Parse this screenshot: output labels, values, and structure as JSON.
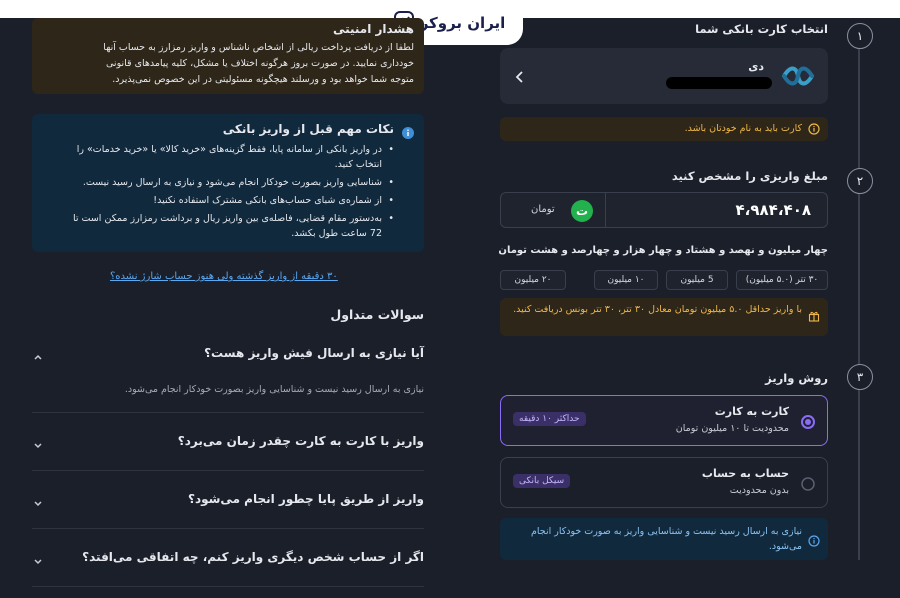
{
  "brand": {
    "logo_text": "ایران بروکر"
  },
  "security_alert": {
    "title": "هشدار امنیتی",
    "lines": [
      "لطفا از دریافت پرداخت ریالی از اشخاص ناشناس و واریز رمزارز به حساب آنها",
      "خودداری نمایید. در صورت بروز هرگونه اختلاف یا مشکل، کلیه پیامدهای قانونی",
      "متوجه شما خواهد بود و ورسلند هیچگونه مسئولیتی در این خصوص نمی‌پذیرد."
    ]
  },
  "important_notes": {
    "title": "نکات مهم قبل از واریز بانکی",
    "items": [
      "در واریز بانکی از سامانه پایا، فقط گزینه‌های «خرید کالا» یا «خرید خدمات» را انتخاب کنید.",
      "شناسایی واریز بصورت خودکار انجام می‌شود و نیازی به ارسال رسید نیست.",
      "از شماره‌ی شبای حساب‌های بانکی مشترک استفاده نکنید!",
      "به‌دستور مقام قضایی، فاصله‌ی بین واریز ریال و برداشت رمزارز ممکن است تا 72 ساعت طول بکشد."
    ]
  },
  "late_deposit_link": "۳۰ دقیقه از واریز گذشته ولی هنوز حساب شارژ نشده؟",
  "faq": {
    "title": "سوالات متداول",
    "items": [
      {
        "question": "آیا نیازی به ارسال فیش واریز هست؟",
        "answer": "نیازی به ارسال رسید نیست و شناسایی واریز بصورت خودکار انجام می‌شود.",
        "expanded": true
      },
      {
        "question": "واریز با کارت به کارت چقدر زمان می‌برد؟",
        "expanded": false
      },
      {
        "question": "واریز از طریق پایا چطور انجام می‌شود؟",
        "expanded": false
      },
      {
        "question": "اگر از حساب شخص دیگری واریز کنم، چه اتفاقی می‌افتد؟",
        "expanded": false
      }
    ]
  },
  "steps": [
    {
      "number": "۱",
      "title": "انتخاب کارت بانکی شما"
    },
    {
      "number": "۲",
      "title": "مبلغ واریزی را مشخص کنید"
    },
    {
      "number": "۳",
      "title": "روش واریز"
    }
  ],
  "bank_card": {
    "bank_name": "دی",
    "number_redacted": true,
    "icon": "bank-dey-logo-icon"
  },
  "card_name_warning": "کارت باید به نام خودتان باشد.",
  "amount": {
    "value": "۴،۹۸۴،۴۰۸",
    "currency": "تومان",
    "currency_icon": "toman-icon",
    "in_words": "چهار میلیون و نهصد و هشتاد و چهار هزار و چهارصد و هشت تومان"
  },
  "quick_amounts": [
    "۳۰ تتر (۵.۰ میلیون)",
    "5 میلیون",
    "۱۰ میلیون",
    "۲۰ میلیون"
  ],
  "bonus_notice": "با واریز حداقل ۵.۰ میلیون تومان معادل ۳۰ تتر، ۳۰ تتر بونس دریافت کنید.",
  "payment_methods": [
    {
      "title": "کارت به کارت",
      "subtitle": "محدودیت تا ۱۰ میلیون تومان",
      "badge": "حداکثر ۱۰ دقیقه",
      "selected": true
    },
    {
      "title": "حساب به حساب",
      "subtitle": "بدون محدودیت",
      "badge": "سیکل بانکی",
      "selected": false
    }
  ],
  "method_info": "نیازی به ارسال رسید نیست و شناسایی واریز به صورت خودکار انجام می‌شود.",
  "colors": {
    "background": "#1b1f2a",
    "accent_purple": "#8b6cf6",
    "warning": "#f0b84a",
    "info_blue": "#3f8fd8",
    "toman_green": "#22b14c"
  }
}
